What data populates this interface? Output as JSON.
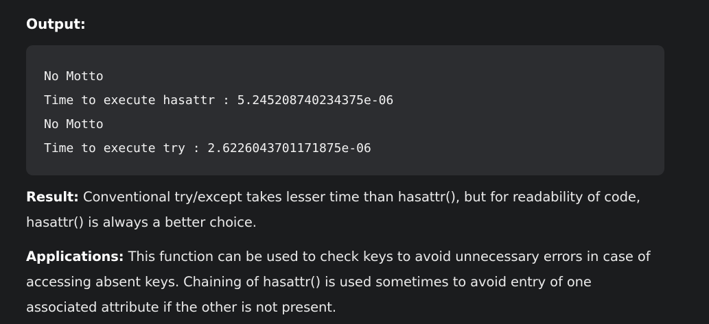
{
  "output_heading": "Output:",
  "code_lines": [
    "No Motto",
    "Time to execute hasattr : 5.245208740234375e-06",
    "No Motto",
    "Time to execute try : 2.6226043701171875e-06"
  ],
  "result": {
    "label": "Result:",
    "text": " Conventional try/except takes lesser time than hasattr(), but for readability of code, hasattr() is always a better choice."
  },
  "applications": {
    "label": "Applications:",
    "text": " This function can be used to check keys to avoid unnecessary errors in case of accessing absent keys. Chaining of hasattr() is used sometimes to avoid entry of one associated attribute if the other is not present."
  }
}
